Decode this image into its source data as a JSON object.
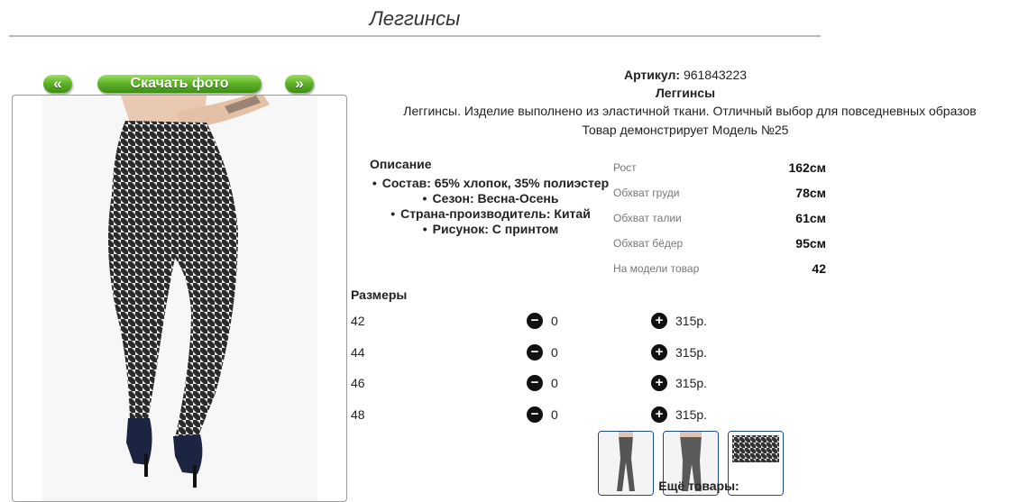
{
  "title": "Леггинсы",
  "nav": {
    "prev_label": "«",
    "download_label": "Скачать фото",
    "next_label": "»"
  },
  "product": {
    "article_label": "Артикул:",
    "article_value": "961843223",
    "name": "Леггинсы",
    "short_description": "Леггинсы. Изделие выполнено из эластичной ткани. Отличный выбор для повседневных образов",
    "model_note": "Товар демонстрирует Модель №25"
  },
  "description": {
    "heading": "Описание",
    "items": [
      "Состав: 65% хлопок, 35% полиэстер",
      "Сезон: Весна-Осень",
      "Страна-производитель: Китай",
      "Рисунок: С принтом"
    ]
  },
  "model_params": [
    {
      "label": "Рост",
      "value": "162см"
    },
    {
      "label": "Обхват груди",
      "value": "78см"
    },
    {
      "label": "Обхват талии",
      "value": "61см"
    },
    {
      "label": "Обхват бёдер",
      "value": "95см"
    },
    {
      "label": "На модели товар",
      "value": "42"
    }
  ],
  "sizes": {
    "heading": "Размеры",
    "rows": [
      {
        "size": "42",
        "qty": "0",
        "price": "315р."
      },
      {
        "size": "44",
        "qty": "0",
        "price": "315р."
      },
      {
        "size": "46",
        "qty": "0",
        "price": "315р."
      },
      {
        "size": "48",
        "qty": "0",
        "price": "315р."
      }
    ]
  },
  "more_goods_label": "Ещё товары:",
  "icons": {
    "minus": "minus-circle-icon",
    "plus": "plus-circle-icon"
  },
  "colors": {
    "button_green": "#5db028",
    "thumb_border": "#1c4b8a",
    "rule": "#bdbdbd"
  }
}
